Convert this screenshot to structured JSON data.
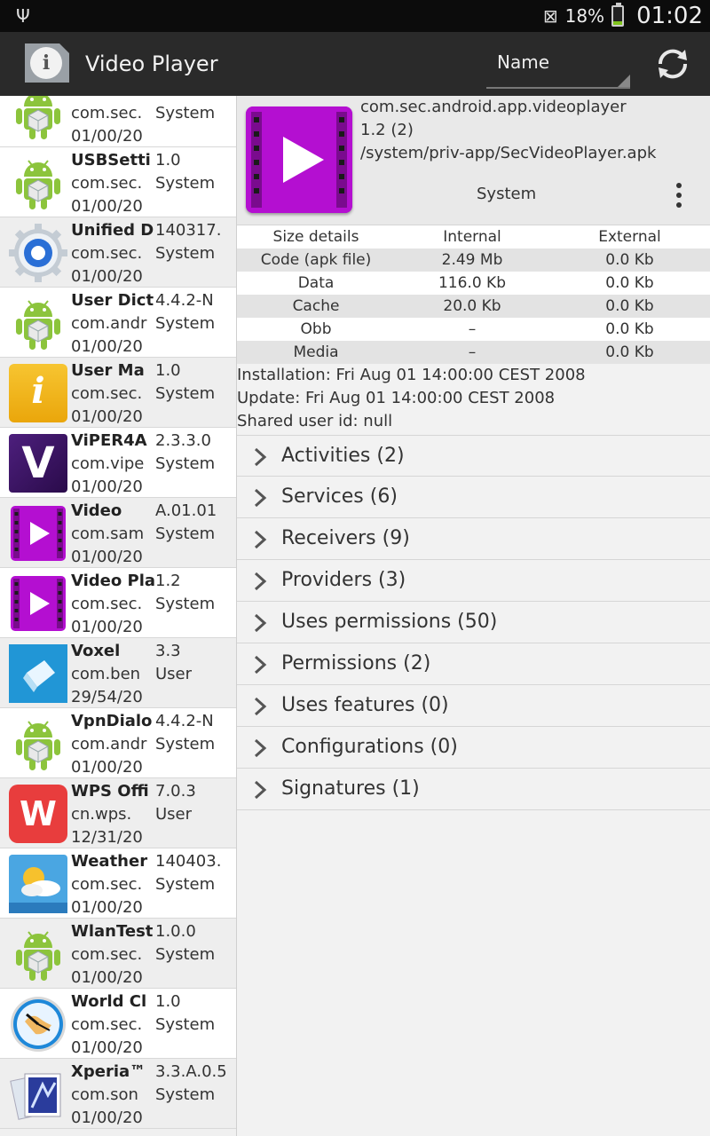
{
  "status_bar": {
    "usb_icon": "usb-icon",
    "mute_icon": "vibrate-mute-icon",
    "battery_percent": "18%",
    "battery_level": 0.18,
    "time": "01:02"
  },
  "action_bar": {
    "title": "Video Player",
    "sort_label": "Name",
    "refresh_icon": "refresh-icon",
    "info_icon": "info-icon"
  },
  "apps": [
    {
      "name": "",
      "version": "",
      "package": "com.sec.",
      "type": "System",
      "date": "01/00/20",
      "icon": "android"
    },
    {
      "name": "USBSetti",
      "version": "1.0",
      "package": "com.sec.",
      "type": "System",
      "date": "01/00/20",
      "icon": "android"
    },
    {
      "name": "Unified D",
      "version": "140317.",
      "package": "com.sec.",
      "type": "System",
      "date": "01/00/20",
      "icon": "gear"
    },
    {
      "name": "User Dict",
      "version": "4.4.2-N",
      "package": "com.andr",
      "type": "System",
      "date": "01/00/20",
      "icon": "android"
    },
    {
      "name": "User Ma",
      "version": "1.0",
      "package": "com.sec.",
      "type": "System",
      "date": "01/00/20",
      "icon": "usermanual"
    },
    {
      "name": "ViPER4A",
      "version": "2.3.3.0",
      "package": "com.vipe",
      "type": "System",
      "date": "01/00/20",
      "icon": "viper"
    },
    {
      "name": "Video",
      "version": "A.01.01",
      "package": "com.sam",
      "type": "System",
      "date": "01/00/20",
      "icon": "video"
    },
    {
      "name": "Video Pla",
      "version": "1.2",
      "package": "com.sec.",
      "type": "System",
      "date": "01/00/20",
      "icon": "video"
    },
    {
      "name": "Voxel",
      "version": "3.3",
      "package": "com.ben",
      "type": "User",
      "date": "29/54/20",
      "icon": "voxel"
    },
    {
      "name": "VpnDialo",
      "version": "4.4.2-N",
      "package": "com.andr",
      "type": "System",
      "date": "01/00/20",
      "icon": "android"
    },
    {
      "name": "WPS Offi",
      "version": "7.0.3",
      "package": "cn.wps.",
      "type": "User",
      "date": "12/31/20",
      "icon": "wps"
    },
    {
      "name": "Weather",
      "version": "140403.",
      "package": "com.sec.",
      "type": "System",
      "date": "01/00/20",
      "icon": "weather"
    },
    {
      "name": "WlanTest",
      "version": "1.0.0",
      "package": "com.sec.",
      "type": "System",
      "date": "01/00/20",
      "icon": "android"
    },
    {
      "name": "World Cl",
      "version": "1.0",
      "package": "com.sec.",
      "type": "System",
      "date": "01/00/20",
      "icon": "clock"
    },
    {
      "name": "Xperia™",
      "version": "3.3.A.0.5",
      "package": "com.son",
      "type": "System",
      "date": "01/00/20",
      "icon": "xperia"
    }
  ],
  "detail": {
    "package": "com.sec.android.app.videoplayer",
    "version": "1.2 (2)",
    "path": "/system/priv-app/SecVideoPlayer.apk",
    "type": "System",
    "size_table": {
      "headers": [
        "Size details",
        "Internal",
        "External"
      ],
      "rows": [
        [
          "Code (apk file)",
          "2.49 Mb",
          "0.0 Kb"
        ],
        [
          "Data",
          "116.0 Kb",
          "0.0 Kb"
        ],
        [
          "Cache",
          "20.0 Kb",
          "0.0 Kb"
        ],
        [
          "Obb",
          "–",
          "0.0 Kb"
        ],
        [
          "Media",
          "–",
          "0.0 Kb"
        ]
      ]
    },
    "installation": "Installation: Fri Aug 01 14:00:00 CEST 2008",
    "update": "Update: Fri Aug 01 14:00:00 CEST 2008",
    "shared_user": "Shared user id: null",
    "sections": [
      "Activities (2)",
      "Services (6)",
      "Receivers (9)",
      "Providers (3)",
      "Uses permissions (50)",
      "Permissions (2)",
      "Uses features (0)",
      "Configurations (0)",
      "Signatures (1)"
    ]
  },
  "colors": {
    "action_bar": "#2a2a2a",
    "video_icon": "#b40fd1",
    "battery": "#7fc31c"
  }
}
